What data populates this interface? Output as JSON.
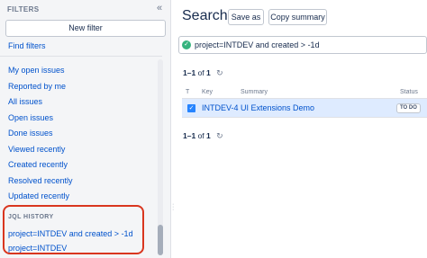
{
  "sidebar": {
    "title": "FILTERS",
    "collapse_icon": "«",
    "new_filter_label": "New filter",
    "find_filters_label": "Find filters",
    "items": [
      {
        "label": "My open issues"
      },
      {
        "label": "Reported by me"
      },
      {
        "label": "All issues"
      },
      {
        "label": "Open issues"
      },
      {
        "label": "Done issues"
      },
      {
        "label": "Viewed recently"
      },
      {
        "label": "Created recently"
      },
      {
        "label": "Resolved recently"
      },
      {
        "label": "Updated recently"
      }
    ],
    "jql_history": {
      "title": "JQL HISTORY",
      "items": [
        {
          "label": "project=INTDEV and created > -1d"
        },
        {
          "label": "project=INTDEV"
        }
      ],
      "highlight_color": "#d9361f"
    }
  },
  "main": {
    "title": "Search",
    "save_as_label": "Save as",
    "copy_summary_label": "Copy summary",
    "query": "project=INTDEV and created > -1d",
    "query_status_icon": "check-circle-icon",
    "results_count": {
      "range": "1–1",
      "of_label": "of",
      "total": "1"
    },
    "table": {
      "columns": {
        "type": "T",
        "key": "Key",
        "summary": "Summary",
        "status": "Status"
      },
      "rows": [
        {
          "key": "INTDEV-4",
          "summary": "UI Extensions Demo",
          "status": "TO DO",
          "checked": true
        }
      ]
    }
  },
  "colors": {
    "link": "#0052cc",
    "selected_row": "#deebff",
    "success": "#36b37e",
    "highlight_outline": "#d9361f"
  }
}
